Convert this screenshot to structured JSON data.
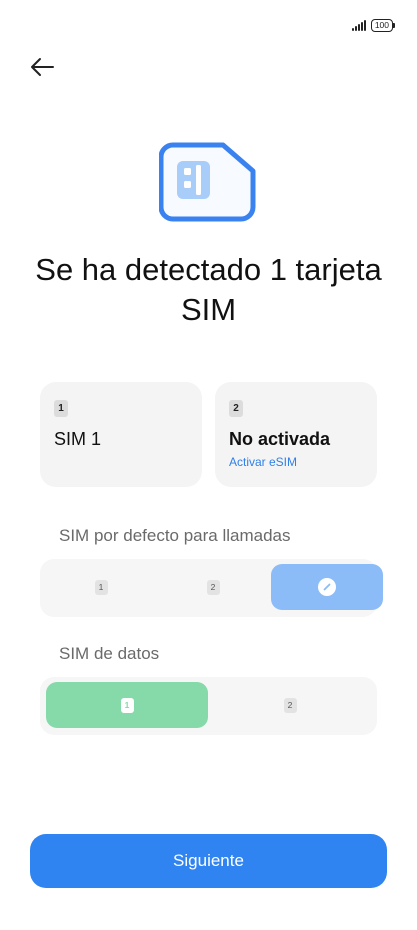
{
  "status_bar": {
    "battery_level": "100",
    "signal_icon": "cellular-signal-icon",
    "battery_icon": "battery-icon"
  },
  "header": {
    "back_icon": "arrow-left-icon"
  },
  "hero": {
    "icon": "sim-card-icon",
    "primary_color": "#3a82f0",
    "accent_color": "#a9cdf9"
  },
  "title": "Se ha detectado 1 tarjeta SIM",
  "sim_cards": [
    {
      "slot": "1",
      "name": "SIM 1",
      "link": ""
    },
    {
      "slot": "2",
      "name": "No activada",
      "link": "Activar eSIM"
    }
  ],
  "calls_section": {
    "label": "SIM por defecto para llamadas",
    "options": [
      "1",
      "2"
    ],
    "selected_option": "always-ask",
    "selected_icon": "checkmark-icon"
  },
  "data_section": {
    "label": "SIM de datos",
    "options": [
      "1",
      "2"
    ],
    "selected_option": "1"
  },
  "footer": {
    "next_label": "Siguiente"
  },
  "colors": {
    "accent_blue": "#2f84f1",
    "selected_blue": "#8cbcf8",
    "selected_green": "#86d9a9",
    "link_blue": "#2f7fe8"
  }
}
